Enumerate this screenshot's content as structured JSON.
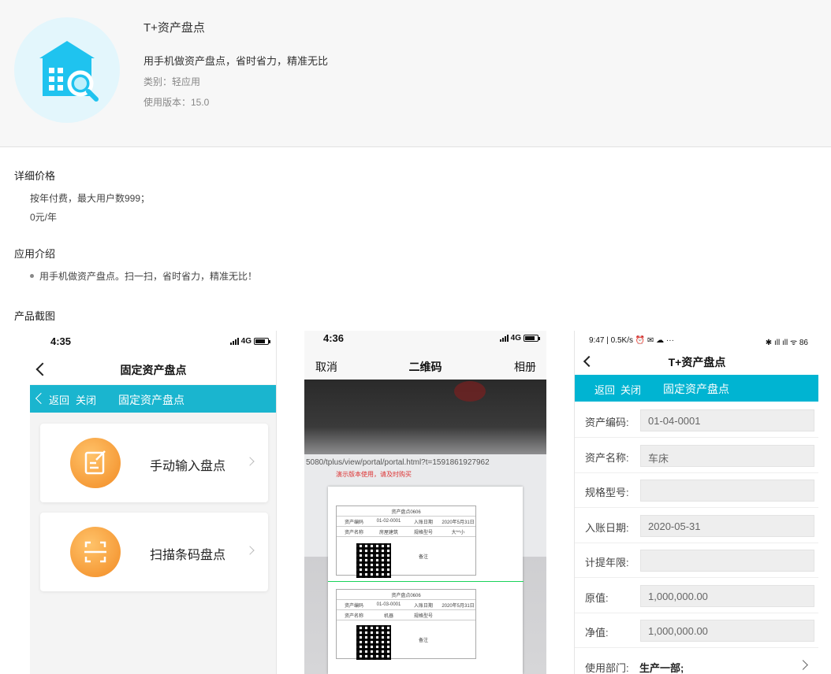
{
  "app": {
    "title": "T+资产盘点",
    "description": "用手机做资产盘点，省时省力，精准无比",
    "category": "类别：轻应用",
    "version": "使用版本：15.0",
    "icon": "house-search-icon",
    "icon_color": "#1fc3ef"
  },
  "pricing": {
    "title": "详细价格",
    "line1": "按年付费，最大用户数999；",
    "line2": "0元/年"
  },
  "intro": {
    "title": "应用介绍",
    "bullet": "用手机做资产盘点。扫一扫，省时省力，精准无比！"
  },
  "screenshots_title": "产品截图",
  "shot1": {
    "time": "4:35",
    "network": "4G",
    "nav_title": "固定资产盘点",
    "bar_back": "返回",
    "bar_close": "关闭",
    "bar_title": "固定资产盘点",
    "accent": "#1ab5cf",
    "cards": [
      {
        "label": "手动输入盘点",
        "icon": "edit-icon"
      },
      {
        "label": "扫描条码盘点",
        "icon": "scan-icon"
      }
    ]
  },
  "shot2": {
    "time": "4:36",
    "network": "4G",
    "cancel": "取消",
    "title": "二维码",
    "album": "相册",
    "url_text": "5080/tplus/view/portal/portal.html?t=1591861927962",
    "warning": "演示版本使用，请及时购买",
    "doc1": {
      "header": "资产盘点0606",
      "rows": [
        [
          "资产编码",
          "01-02-0001",
          "入账日期",
          "2020年5月31日"
        ],
        [
          "资产名称",
          "房屋建筑",
          "规格型号",
          "大**小"
        ]
      ],
      "note": "备注"
    },
    "doc2": {
      "header": "资产盘点0606",
      "rows": [
        [
          "资产编码",
          "01-03-0001",
          "入账日期",
          "2020年5月31日"
        ],
        [
          "资产名称",
          "机器",
          "规格型号",
          ""
        ]
      ],
      "note": "备注"
    }
  },
  "shot3": {
    "status_left": "9:47 | 0.5K/s ⏰ ✉ ☁ ···",
    "status_right": "✱ ıll ıll ᯤ 86",
    "nav_title": "T+资产盘点",
    "bar_back": "返回",
    "bar_close": "关闭",
    "bar_title": "固定资产盘点",
    "accent": "#00b4d2",
    "fields": [
      {
        "label": "资产编码:",
        "value": "01-04-0001"
      },
      {
        "label": "资产名称:",
        "value": "车床"
      },
      {
        "label": "规格型号:",
        "value": ""
      },
      {
        "label": "入账日期:",
        "value": "2020-05-31"
      },
      {
        "label": "计提年限:",
        "value": ""
      },
      {
        "label": "原值:",
        "value": "1,000,000.00"
      },
      {
        "label": "净值:",
        "value": "1,000,000.00"
      }
    ],
    "dept_label": "使用部门:",
    "dept_value": "生产一部;"
  }
}
